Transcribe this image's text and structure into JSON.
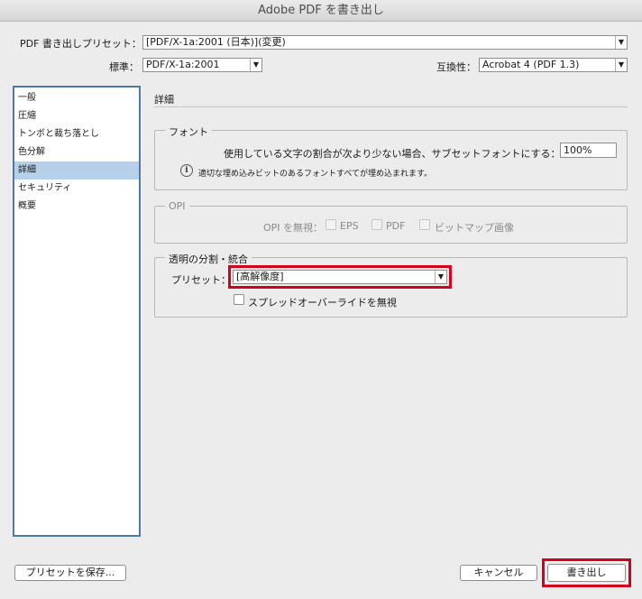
{
  "window": {
    "title": "Adobe PDF を書き出し"
  },
  "preset": {
    "label": "PDF 書き出しプリセット：",
    "value": "[PDF/X-1a:2001 (日本)](変更)"
  },
  "standard": {
    "label": "標準：",
    "value": "PDF/X-1a:2001"
  },
  "compatibility": {
    "label": "互換性：",
    "value": "Acrobat 4 (PDF 1.3)"
  },
  "sidebar": {
    "items": [
      {
        "label": "一般"
      },
      {
        "label": "圧縮"
      },
      {
        "label": "トンボと裁ち落とし"
      },
      {
        "label": "色分解"
      },
      {
        "label": "詳細",
        "selected": true
      },
      {
        "label": "セキュリティ"
      },
      {
        "label": "概要"
      }
    ]
  },
  "panel": {
    "title": "詳細",
    "fonts": {
      "group_title": "フォント",
      "subset_label": "使用している文字の割合が次より少ない場合、サブセットフォントにする：",
      "subset_value": "100%",
      "info_text": "適切な埋め込みビットのあるフォントすべてが埋め込まれます。"
    },
    "opi": {
      "group_title": "OPI",
      "omit_label": "OPI を無視：",
      "eps": "EPS",
      "pdf": "PDF",
      "bitmap": "ビットマップ画像"
    },
    "flattener": {
      "group_title": "透明の分割・統合",
      "preset_label": "プリセット：",
      "preset_value": "[高解像度]",
      "ignore_spread": "スプレッドオーバーライドを無視"
    }
  },
  "buttons": {
    "save_preset": "プリセットを保存...",
    "cancel": "キャンセル",
    "export": "書き出し"
  },
  "colors": {
    "highlight": "#d6001c",
    "selection": "#b6d0ea",
    "sidebar_border": "#4b7aa6"
  }
}
